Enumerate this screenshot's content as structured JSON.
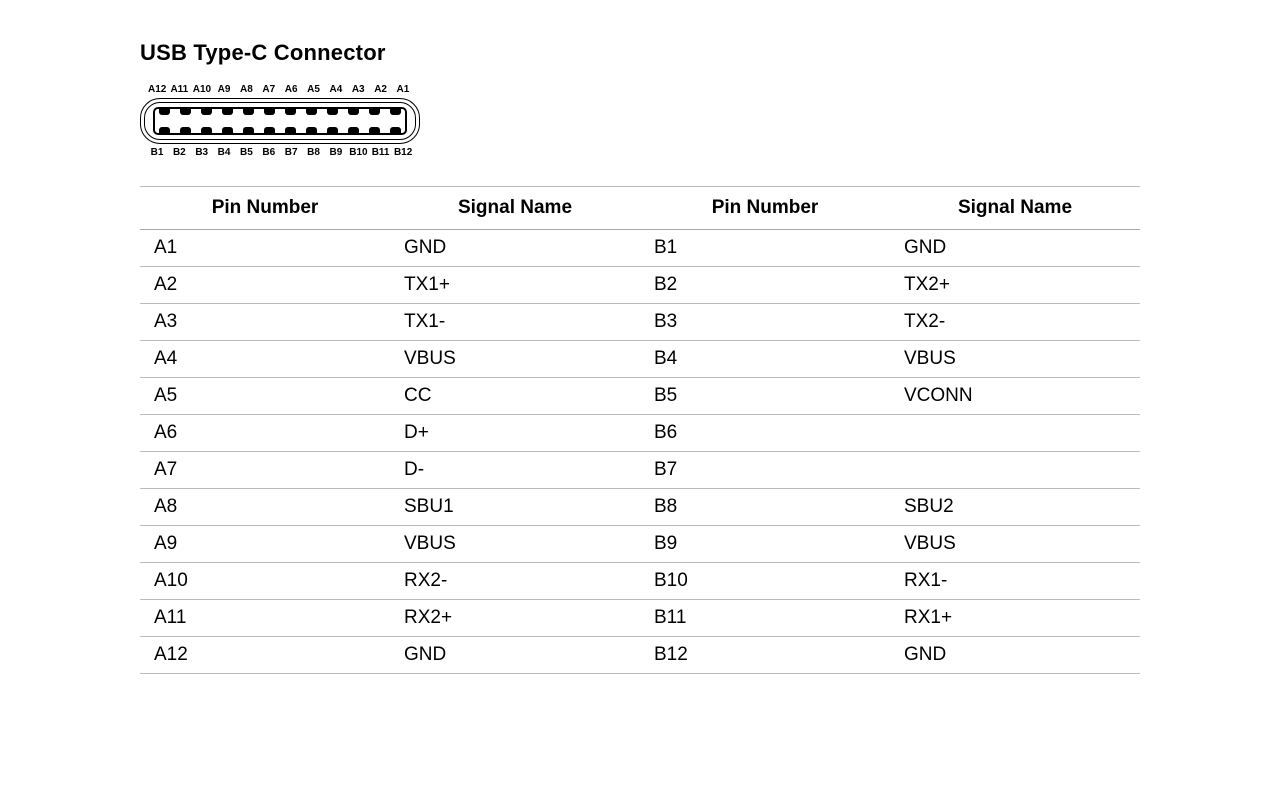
{
  "title": "USB Type-C Connector",
  "connector": {
    "top_labels": [
      "A12",
      "A11",
      "A10",
      "A9",
      "A8",
      "A7",
      "A6",
      "A5",
      "A4",
      "A3",
      "A2",
      "A1"
    ],
    "bottom_labels": [
      "B1",
      "B2",
      "B3",
      "B4",
      "B5",
      "B6",
      "B7",
      "B8",
      "B9",
      "B10",
      "B11",
      "B12"
    ],
    "contact_count": 12,
    "icon_name": "usb-c-connector-icon"
  },
  "table": {
    "headers": [
      "Pin Number",
      "Signal Name",
      "Pin Number",
      "Signal Name"
    ],
    "rows": [
      [
        "A1",
        "GND",
        "B1",
        "GND"
      ],
      [
        "A2",
        "TX1+",
        "B2",
        "TX2+"
      ],
      [
        "A3",
        "TX1-",
        "B3",
        "TX2-"
      ],
      [
        "A4",
        "VBUS",
        "B4",
        "VBUS"
      ],
      [
        "A5",
        "CC",
        "B5",
        "VCONN"
      ],
      [
        "A6",
        "D+",
        "B6",
        ""
      ],
      [
        "A7",
        "D-",
        "B7",
        ""
      ],
      [
        "A8",
        "SBU1",
        "B8",
        "SBU2"
      ],
      [
        "A9",
        "VBUS",
        "B9",
        "VBUS"
      ],
      [
        "A10",
        "RX2-",
        "B10",
        "RX1-"
      ],
      [
        "A11",
        "RX2+",
        "B11",
        "RX1+"
      ],
      [
        "A12",
        "GND",
        "B12",
        "GND"
      ]
    ]
  }
}
